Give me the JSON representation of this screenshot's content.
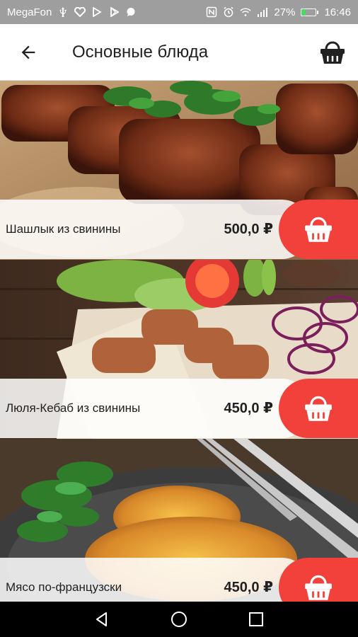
{
  "status_bar": {
    "carrier": "MegaFon",
    "battery_text": "27%",
    "battery_level": 0.27,
    "time": "16:46",
    "left_icons": [
      "usb-icon",
      "heart-icon",
      "play-store-icon",
      "play-icon",
      "chat-icon"
    ],
    "right_icons": [
      "nfc-icon",
      "alarm-icon",
      "wifi-icon",
      "signal-icon",
      "battery-icon"
    ]
  },
  "app_bar": {
    "title": "Основные блюда",
    "back_icon": "arrow-left-icon",
    "cart_icon": "basket-icon"
  },
  "dishes": [
    {
      "name": "Шашлык из свинины",
      "price": "500,0 ₽",
      "photo": "shashlik-photo"
    },
    {
      "name": "Люля-Кебаб из свинины",
      "price": "450,0 ₽",
      "photo": "kebab-photo"
    },
    {
      "name": "Мясо по-французски",
      "price": "450,0 ₽",
      "photo": "french-meat-photo"
    }
  ],
  "nav_bar": {
    "icons": [
      "back-triangle-icon",
      "home-circle-icon",
      "recents-square-icon"
    ]
  },
  "colors": {
    "accent": "#f2403a",
    "status_bar": "#9e9e9e",
    "nav_bar": "#000000",
    "battery": "#4cd964"
  }
}
